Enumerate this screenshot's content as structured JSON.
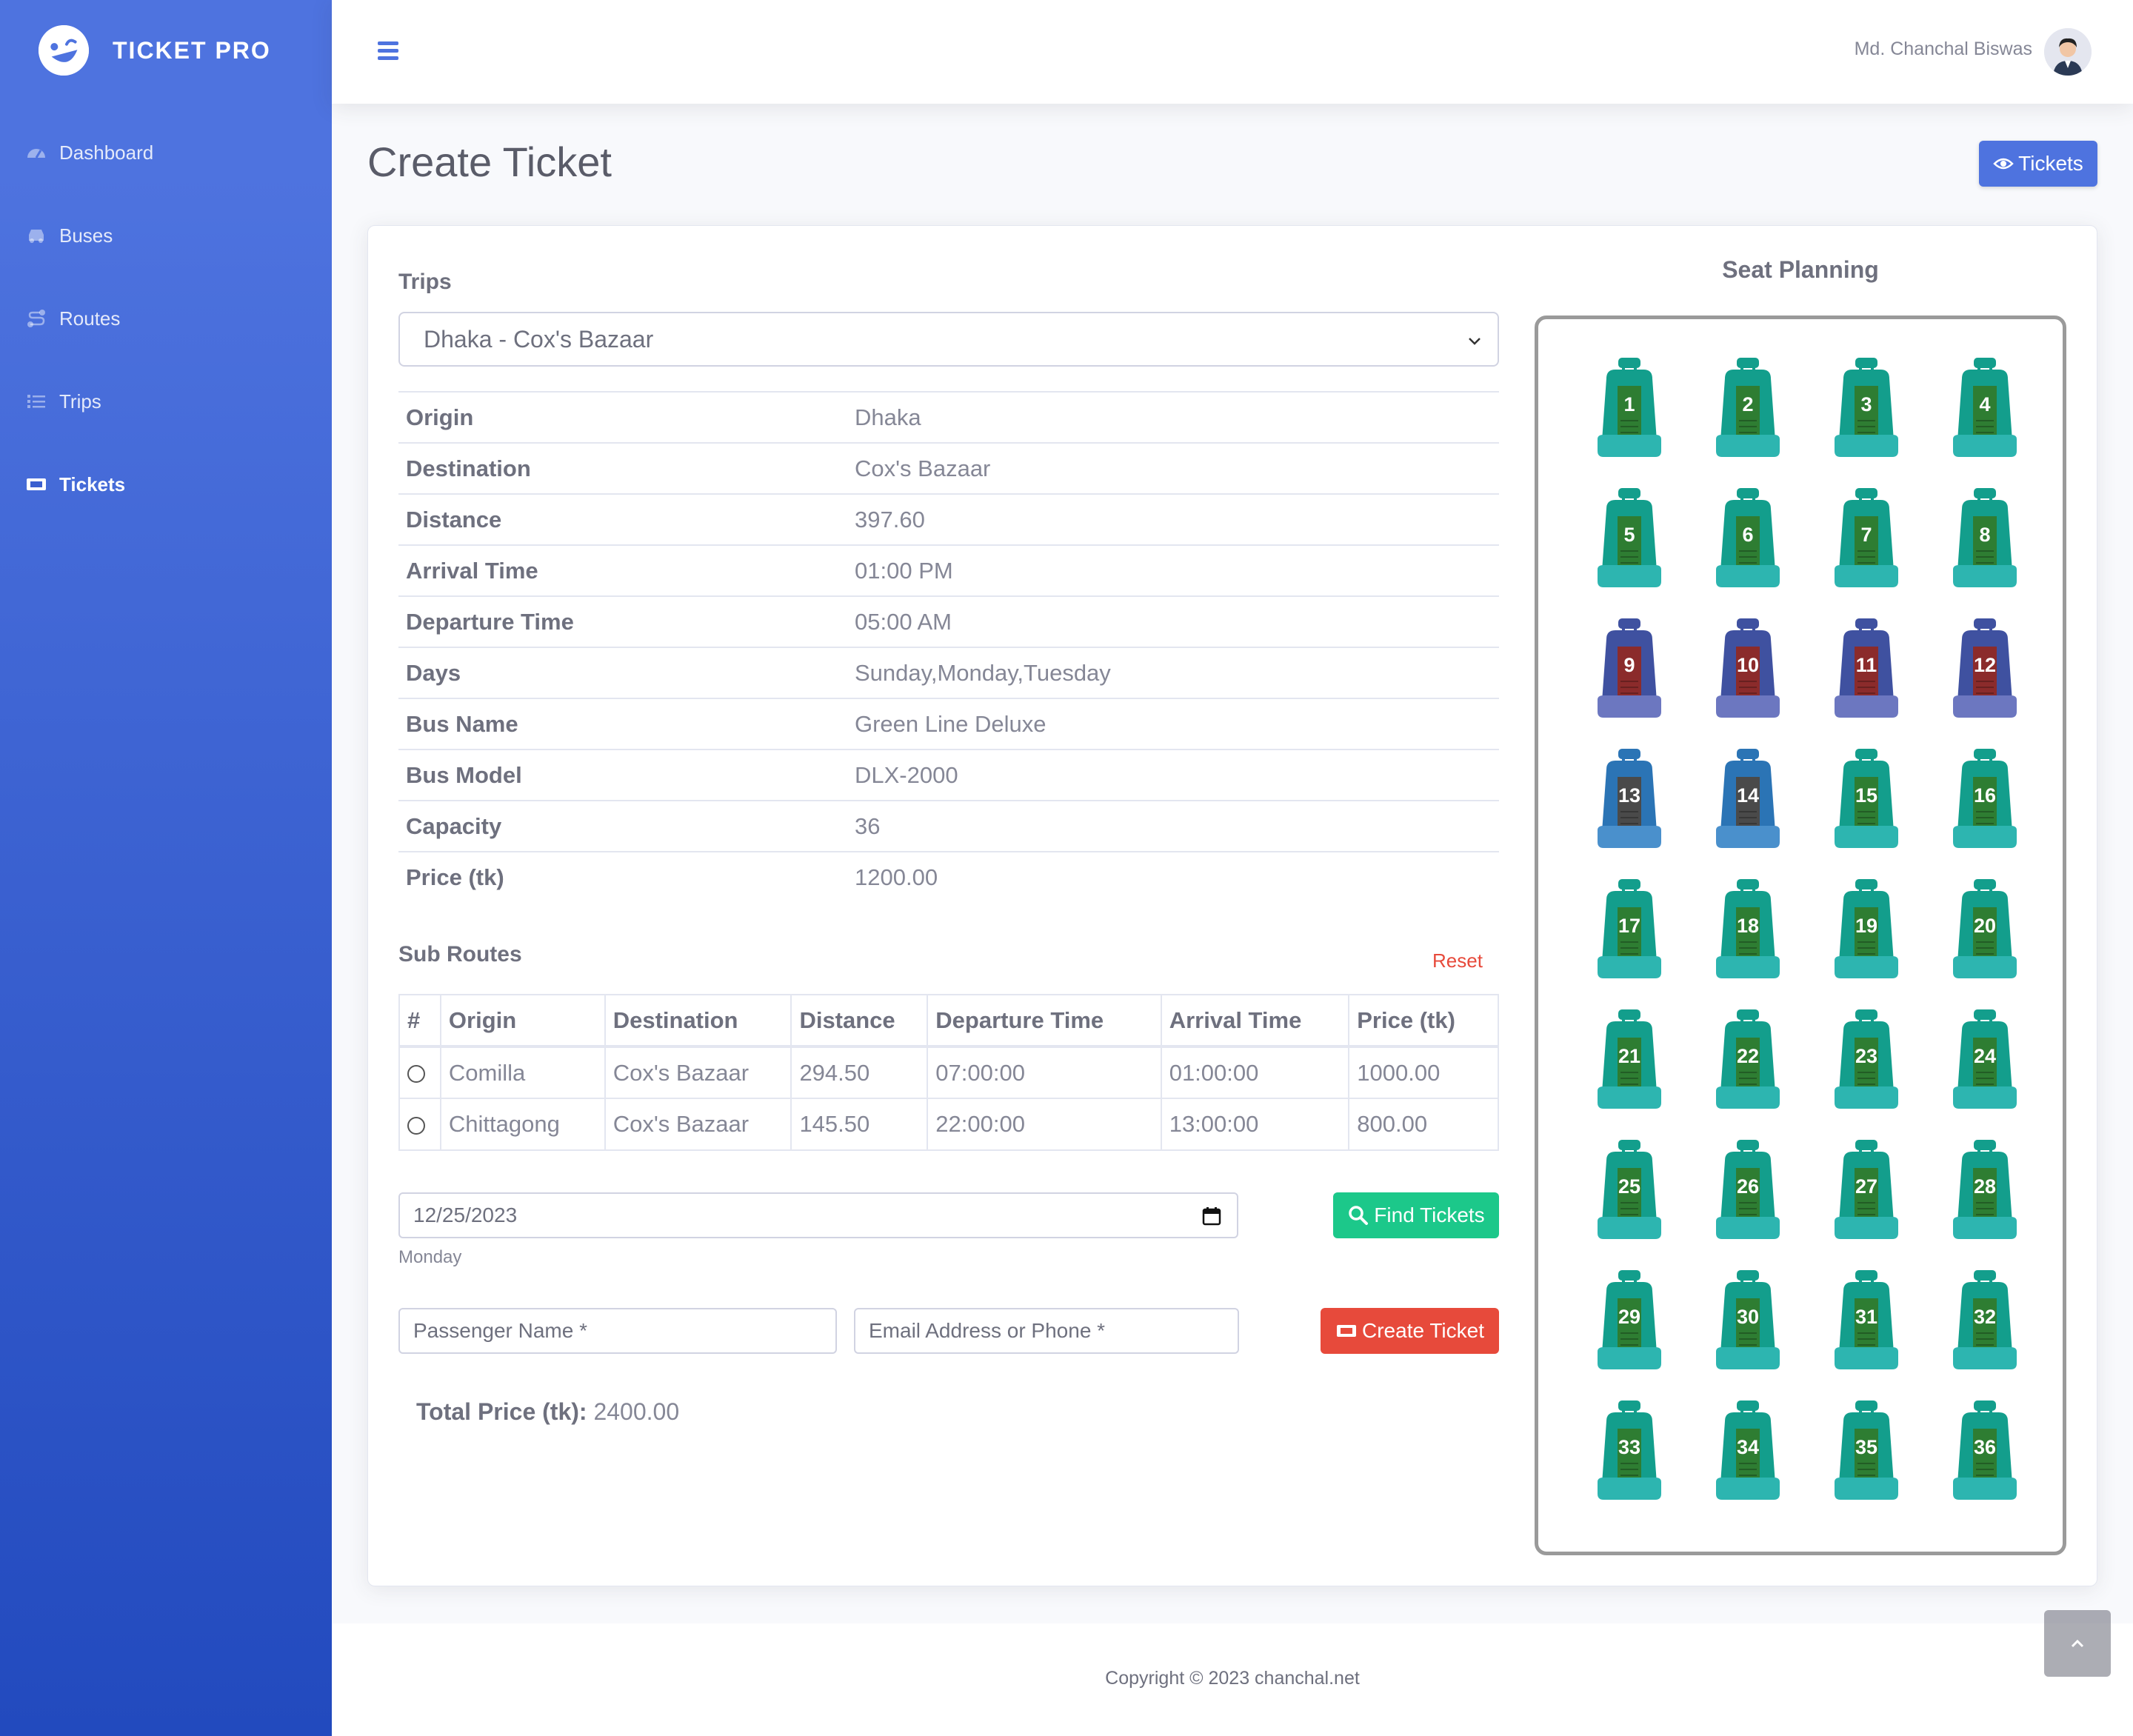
{
  "brand": {
    "name": "TICKET PRO"
  },
  "sidebar": {
    "items": [
      {
        "label": "Dashboard",
        "icon": "tachometer-icon",
        "active": false
      },
      {
        "label": "Buses",
        "icon": "car-icon",
        "active": false
      },
      {
        "label": "Routes",
        "icon": "route-icon",
        "active": false
      },
      {
        "label": "Trips",
        "icon": "list-icon",
        "active": false
      },
      {
        "label": "Tickets",
        "icon": "ticket-icon",
        "active": true
      }
    ]
  },
  "topbar": {
    "user_name": "Md. Chanchal Biswas"
  },
  "page": {
    "title": "Create Ticket",
    "tickets_button": "Tickets"
  },
  "form": {
    "trips_label": "Trips",
    "trip_selected": "Dhaka - Cox's Bazaar",
    "info": [
      {
        "k": "Origin",
        "v": "Dhaka"
      },
      {
        "k": "Destination",
        "v": "Cox's Bazaar"
      },
      {
        "k": "Distance",
        "v": "397.60"
      },
      {
        "k": "Arrival Time",
        "v": "01:00 PM"
      },
      {
        "k": "Departure Time",
        "v": "05:00 AM"
      },
      {
        "k": "Days",
        "v": "Sunday,Monday,Tuesday"
      },
      {
        "k": "Bus Name",
        "v": "Green Line Deluxe"
      },
      {
        "k": "Bus Model",
        "v": "DLX-2000"
      },
      {
        "k": "Capacity",
        "v": "36"
      },
      {
        "k": "Price (tk)",
        "v": "1200.00"
      }
    ],
    "sub_routes_title": "Sub Routes",
    "reset_label": "Reset",
    "sub_routes_headers": [
      "#",
      "Origin",
      "Destination",
      "Distance",
      "Departure Time",
      "Arrival Time",
      "Price (tk)"
    ],
    "sub_routes": [
      [
        "Comilla",
        "Cox's Bazaar",
        "294.50",
        "07:00:00",
        "01:00:00",
        "1000.00"
      ],
      [
        "Chittagong",
        "Cox's Bazaar",
        "145.50",
        "22:00:00",
        "13:00:00",
        "800.00"
      ]
    ],
    "date_value": "12/25/2023",
    "day_text": "Monday",
    "find_button": "Find Tickets",
    "passenger_placeholder": "Passenger Name *",
    "email_placeholder": "Email Address or Phone *",
    "create_button": "Create Ticket",
    "total_label": "Total Price (tk):",
    "total_value": "2400.00"
  },
  "seat_planning": {
    "title": "Seat Planning",
    "seats": [
      {
        "n": "1",
        "state": "available"
      },
      {
        "n": "2",
        "state": "available"
      },
      {
        "n": "3",
        "state": "available"
      },
      {
        "n": "4",
        "state": "available"
      },
      {
        "n": "5",
        "state": "available"
      },
      {
        "n": "6",
        "state": "available"
      },
      {
        "n": "7",
        "state": "available"
      },
      {
        "n": "8",
        "state": "available"
      },
      {
        "n": "9",
        "state": "booked"
      },
      {
        "n": "10",
        "state": "booked"
      },
      {
        "n": "11",
        "state": "booked"
      },
      {
        "n": "12",
        "state": "booked"
      },
      {
        "n": "13",
        "state": "selected"
      },
      {
        "n": "14",
        "state": "selected"
      },
      {
        "n": "15",
        "state": "available"
      },
      {
        "n": "16",
        "state": "available"
      },
      {
        "n": "17",
        "state": "available"
      },
      {
        "n": "18",
        "state": "available"
      },
      {
        "n": "19",
        "state": "available"
      },
      {
        "n": "20",
        "state": "available"
      },
      {
        "n": "21",
        "state": "available"
      },
      {
        "n": "22",
        "state": "available"
      },
      {
        "n": "23",
        "state": "available"
      },
      {
        "n": "24",
        "state": "available"
      },
      {
        "n": "25",
        "state": "available"
      },
      {
        "n": "26",
        "state": "available"
      },
      {
        "n": "27",
        "state": "available"
      },
      {
        "n": "28",
        "state": "available"
      },
      {
        "n": "29",
        "state": "available"
      },
      {
        "n": "30",
        "state": "available"
      },
      {
        "n": "31",
        "state": "available"
      },
      {
        "n": "32",
        "state": "available"
      },
      {
        "n": "33",
        "state": "available"
      },
      {
        "n": "34",
        "state": "available"
      },
      {
        "n": "35",
        "state": "available"
      },
      {
        "n": "36",
        "state": "available"
      }
    ],
    "colors": {
      "available": {
        "body": "#139e8c",
        "base": "#2db5b0",
        "panel": "#2e7d32"
      },
      "booked": {
        "body": "#3f51a0",
        "base": "#6c77c0",
        "panel": "#8b2b2b"
      },
      "selected": {
        "body": "#2b74b5",
        "base": "#4a90cc",
        "panel": "#4a4a4a"
      }
    }
  },
  "footer": {
    "copyright": "Copyright © 2023 chanchal.net"
  }
}
